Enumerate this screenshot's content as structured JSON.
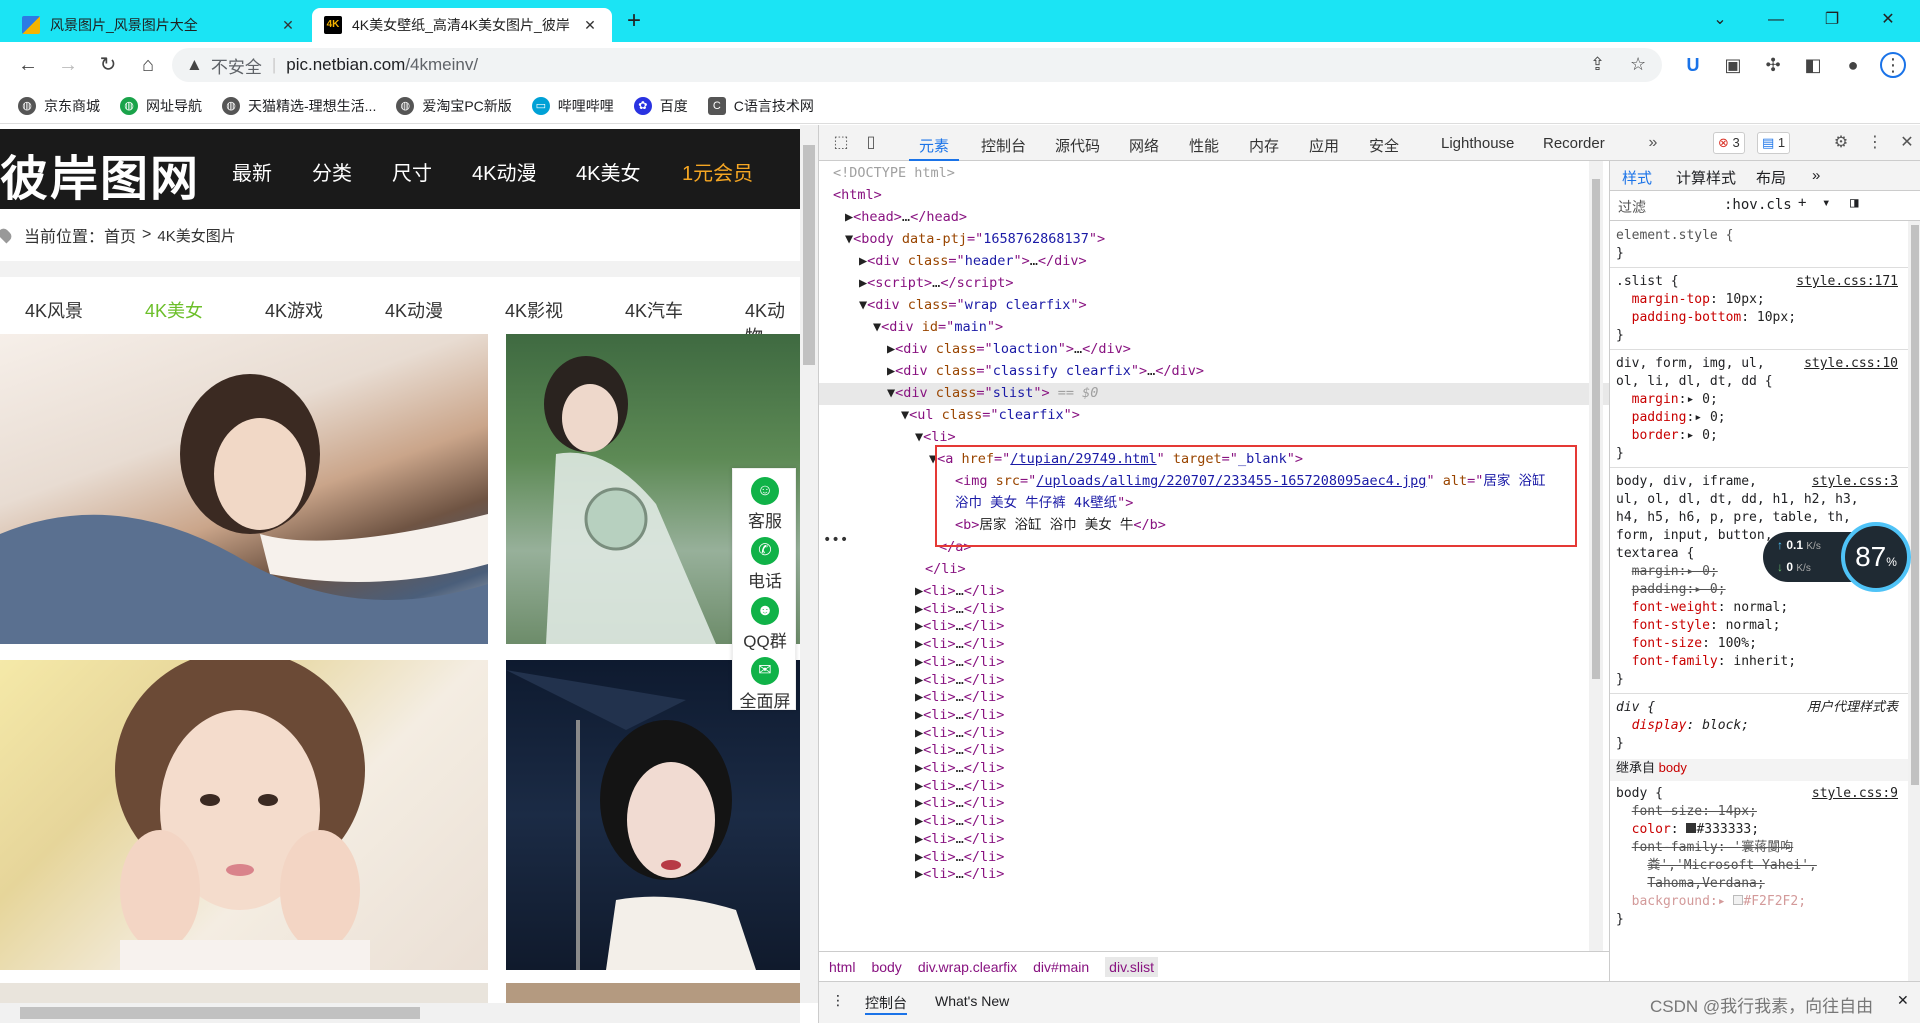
{
  "browser": {
    "tabs": [
      {
        "title": "风景图片_风景图片大全",
        "active": false,
        "color": "#2b7be4"
      },
      {
        "title": "4K美女壁纸_高清4K美女图片_彼岸",
        "active": true,
        "color": "#000000"
      }
    ],
    "url_warning": "不安全",
    "url_host": "pic.netbian.com",
    "url_path": "/4kmeinv/",
    "bookmarks": [
      "京东商城",
      "网址导航",
      "天猫精选-理想生活...",
      "爱淘宝PC新版",
      "哔哩哔哩",
      "百度",
      "C语言技术网"
    ]
  },
  "site": {
    "logo": "彼岸图网",
    "nav": [
      "最新",
      "分类",
      "尺寸",
      "4K动漫",
      "4K美女",
      "1元会员"
    ],
    "breadcrumb_label": "当前位置：",
    "breadcrumb_home": "首页",
    "breadcrumb_sep": ">",
    "breadcrumb_current": "4K美女图片",
    "categories": [
      "4K风景",
      "4K美女",
      "4K游戏",
      "4K动漫",
      "4K影视",
      "4K汽车",
      "4K动物"
    ],
    "active_category": "4K美女",
    "side_widget": [
      "客服",
      "电话",
      "QQ群",
      "全面屏"
    ]
  },
  "devtools": {
    "tabs": [
      "元素",
      "控制台",
      "源代码",
      "网络",
      "性能",
      "内存",
      "应用",
      "安全",
      "Lighthouse",
      "Recorder"
    ],
    "errors": "3",
    "messages": "1",
    "dom": {
      "doctype": "<!DOCTYPE html>",
      "body_ptj": "1658762868137",
      "href": "/tupian/29749.html",
      "target": "_blank",
      "src": "/uploads/allimg/220707/233455-1657208095aec4.jpg",
      "alt_a": "居家 浴缸",
      "alt_b": "浴巾 美女 牛仔裤 4k壁纸",
      "b_text": "居家 浴缸 浴巾 美女 牛",
      "selected_marker": "== $0",
      "collapsed_li_count": 17
    },
    "breadcrumbs": [
      "html",
      "body",
      "div.wrap.clearfix",
      "div#main",
      "div.slist"
    ],
    "drawer_tabs": [
      "控制台",
      "What's New"
    ],
    "styles_tabs": [
      "样式",
      "计算样式",
      "布局"
    ],
    "filter_placeholder": "过滤",
    "hov": ":hov",
    "cls": ".cls",
    "inherited_label": "继承自",
    "inherited_from": "body",
    "ua_label": "用户代理样式表",
    "net_up": "0.1",
    "net_down": "0",
    "net_unit": "K/s",
    "net_pct": "87",
    "watermark": "CSDN @我行我素，向往自由"
  }
}
